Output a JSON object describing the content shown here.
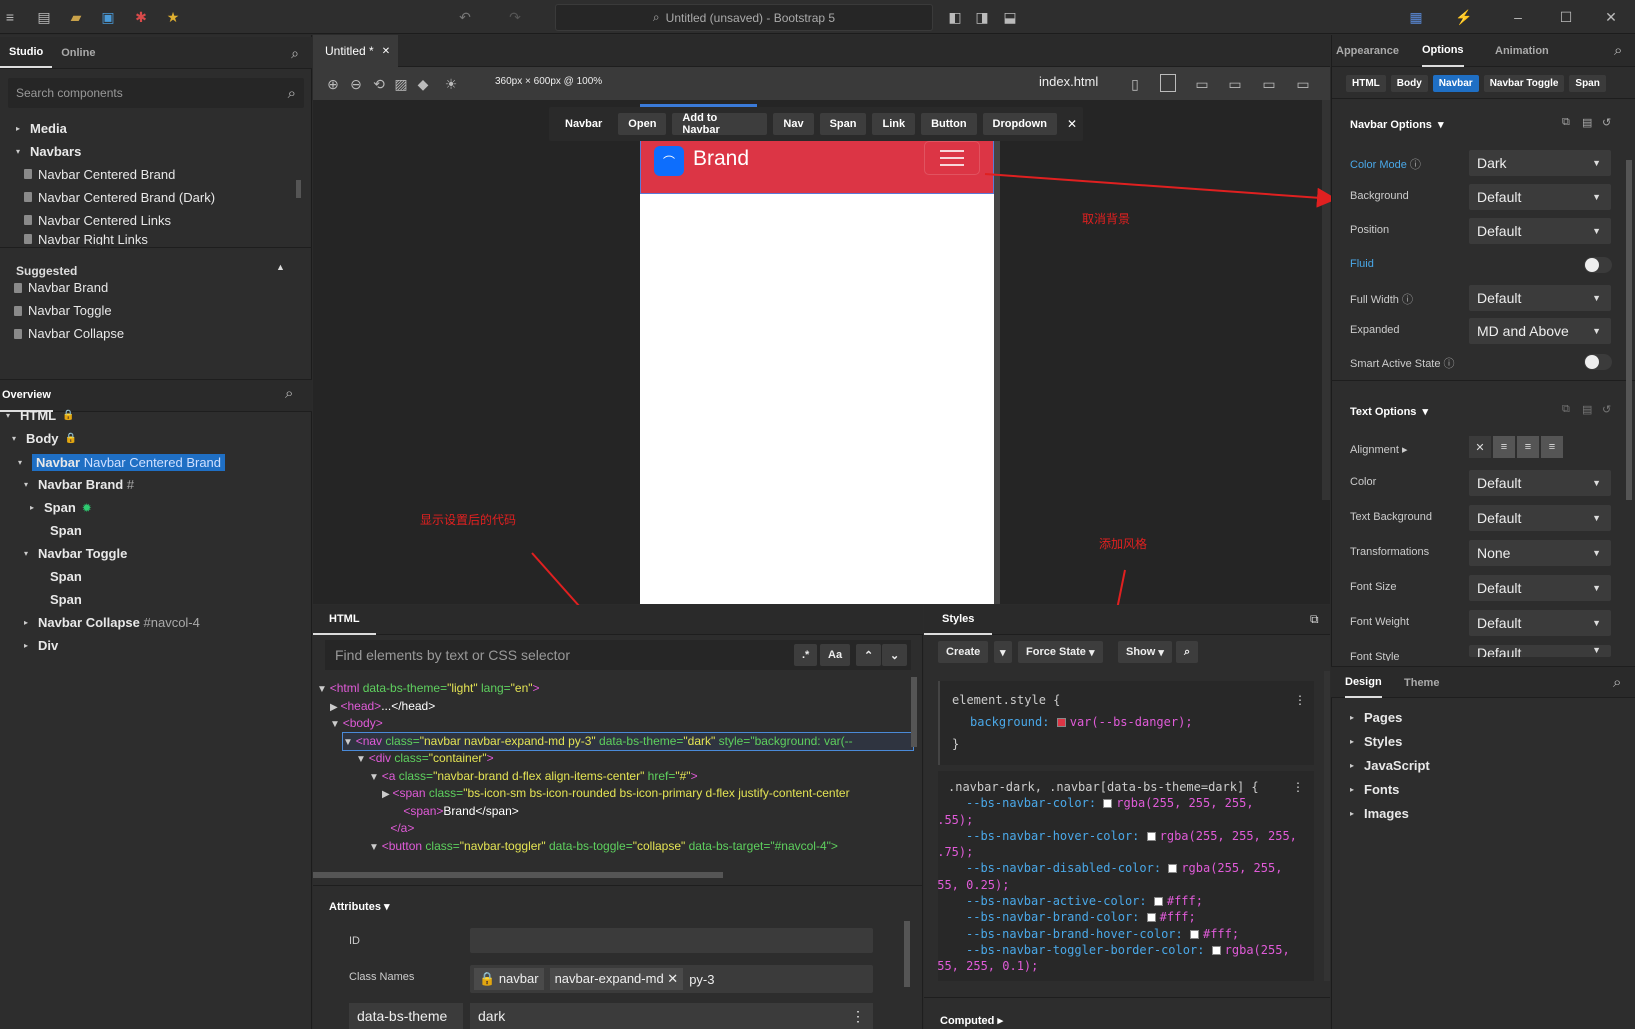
{
  "title_bar": {
    "title": "Untitled (unsaved) - Bootstrap 5"
  },
  "left": {
    "tabs": [
      "Studio",
      "Online"
    ],
    "search_placeholder": "Search components",
    "components": [
      {
        "label": "Media",
        "kind": "group",
        "expanded": false
      },
      {
        "label": "Navbars",
        "kind": "group",
        "expanded": true
      },
      {
        "label": "Navbar Centered Brand",
        "kind": "item"
      },
      {
        "label": "Navbar Centered Brand (Dark)",
        "kind": "item"
      },
      {
        "label": "Navbar Centered Links",
        "kind": "item"
      },
      {
        "label": "Navbar Right Links",
        "kind": "item"
      }
    ],
    "suggested_title": "Suggested",
    "suggested": [
      "Navbar Brand",
      "Navbar Toggle",
      "Navbar Collapse"
    ],
    "overview_title": "Overview",
    "overview": [
      {
        "label": "HTML",
        "sub": ""
      },
      {
        "label": "Body",
        "sub": ""
      },
      {
        "label": "Navbar",
        "sub": "Navbar Centered Brand"
      },
      {
        "label": "Navbar Brand",
        "sub": "#"
      },
      {
        "label": "Span",
        "sub": ""
      },
      {
        "label": "Span",
        "sub": ""
      },
      {
        "label": "Navbar Toggle",
        "sub": ""
      },
      {
        "label": "Span",
        "sub": ""
      },
      {
        "label": "Span",
        "sub": ""
      },
      {
        "label": "Navbar Collapse",
        "sub": "#navcol-4"
      },
      {
        "label": "Div",
        "sub": ""
      }
    ]
  },
  "editor": {
    "tab": "Untitled *",
    "viewport": "360px × 600px @ 100%",
    "file": "index.html",
    "context_bar": [
      "Navbar",
      "Open",
      "Add to Navbar",
      "Nav",
      "Span",
      "Link",
      "Button",
      "Dropdown"
    ],
    "brand": "Brand",
    "navbar_color": "#dc3545"
  },
  "annotations": {
    "remove_bg": "取消背景",
    "show_code": "显示设置后的代码",
    "add_style": "添加风格"
  },
  "html_panel": {
    "title": "HTML",
    "find_placeholder": "Find elements by text or CSS selector",
    "case_btn": "Aa",
    "lines": [
      {
        "tag": "<html ",
        "attr": "data-bs-theme=",
        "val": "\"light\"",
        "attr2": " lang=",
        "val2": "\"en\"",
        "tail": ">"
      },
      {
        "tag": "<head>",
        "attr": "",
        "val": "",
        "attr2": "",
        "val2": "",
        "tail": "...</head>"
      },
      {
        "tag": "<body>",
        "attr": "",
        "val": "",
        "attr2": "",
        "val2": "",
        "tail": ""
      },
      {
        "tag": "<nav ",
        "attr": "class=",
        "val": "\"navbar navbar-expand-md py-3\"",
        "attr2": " data-bs-theme=",
        "val2": "\"dark\"",
        "tail": " style=\"background: var(--"
      },
      {
        "tag": "<div ",
        "attr": "class=",
        "val": "\"container\"",
        "attr2": "",
        "val2": "",
        "tail": ">"
      },
      {
        "tag": "<a ",
        "attr": "class=",
        "val": "\"navbar-brand d-flex align-items-center\"",
        "attr2": " href=",
        "val2": "\"#\"",
        "tail": ">"
      },
      {
        "tag": "<span ",
        "attr": "class=",
        "val": "\"bs-icon-sm bs-icon-rounded bs-icon-primary d-flex justify-content-center",
        "attr2": "",
        "val2": "",
        "tail": ""
      },
      {
        "tag": "<span>",
        "attr": "",
        "val": "",
        "attr2": "",
        "val2": "",
        "tail": "Brand</span>"
      },
      {
        "tag": "</a>",
        "attr": "",
        "val": "",
        "attr2": "",
        "val2": "",
        "tail": ""
      },
      {
        "tag": "<button ",
        "attr": "class=",
        "val": "\"navbar-toggler\"",
        "attr2": " data-bs-toggle=",
        "val2": "\"collapse\"",
        "tail": " data-bs-target=\"#navcol-4\">"
      }
    ]
  },
  "attributes": {
    "title": "Attributes",
    "id_label": "ID",
    "class_label": "Class Names",
    "classes": [
      "navbar",
      "navbar-expand-md"
    ],
    "class_input": "py-3",
    "attr_name": "data-bs-theme",
    "attr_value": "dark"
  },
  "styles": {
    "title": "Styles",
    "buttons": [
      "Create",
      "Force State",
      "Show"
    ],
    "element_style_selector": "element.style {",
    "element_style_prop": "background:",
    "element_style_val": "var(--bs-danger);",
    "rule_selector": ".navbar-dark, .navbar[data-bs-theme=dark] {",
    "rule_lines": [
      {
        "prop": "--bs-navbar-color:",
        "val": "rgba(255, 255, 255,",
        "cont": "0.55);"
      },
      {
        "prop": "--bs-navbar-hover-color:",
        "val": "rgba(255, 255, 255,",
        "cont": "0.75);"
      },
      {
        "prop": "--bs-navbar-disabled-color:",
        "val": "rgba(255, 255,",
        "cont": "255, 0.25);"
      },
      {
        "prop": "--bs-navbar-active-color:",
        "val": "#fff;",
        "cont": ""
      },
      {
        "prop": "--bs-navbar-brand-color:",
        "val": "#fff;",
        "cont": ""
      },
      {
        "prop": "--bs-navbar-brand-hover-color:",
        "val": "#fff;",
        "cont": ""
      },
      {
        "prop": "--bs-navbar-toggler-border-color:",
        "val": "rgba(255,",
        "cont": "255, 255, 0.1);"
      }
    ],
    "computed": "Computed"
  },
  "right": {
    "tabs": [
      "Appearance",
      "Options",
      "Animation"
    ],
    "crumbs": [
      "HTML",
      "Body",
      "Navbar",
      "Navbar Toggle",
      "Span"
    ],
    "navbar_options_title": "Navbar Options",
    "navbar_options": [
      {
        "label": "Color Mode",
        "value": "Dark",
        "type": "select",
        "help": true,
        "blue": true
      },
      {
        "label": "Background",
        "value": "Default",
        "type": "select",
        "help": false,
        "blue": false
      },
      {
        "label": "Position",
        "value": "Default",
        "type": "select",
        "help": false,
        "blue": false
      },
      {
        "label": "Fluid",
        "value": "",
        "type": "toggle",
        "help": false,
        "blue": true
      },
      {
        "label": "Full Width",
        "value": "Default",
        "type": "select",
        "help": true,
        "blue": false
      },
      {
        "label": "Expanded",
        "value": "MD and Above",
        "type": "select",
        "help": false,
        "blue": false
      },
      {
        "label": "Smart Active State",
        "value": "",
        "type": "toggle",
        "help": true,
        "blue": false
      }
    ],
    "text_options_title": "Text Options",
    "alignment_label": "Alignment",
    "text_options": [
      {
        "label": "Color",
        "value": "Default"
      },
      {
        "label": "Text Background",
        "value": "Default"
      },
      {
        "label": "Transformations",
        "value": "None"
      },
      {
        "label": "Font Size",
        "value": "Default"
      },
      {
        "label": "Font Weight",
        "value": "Default"
      },
      {
        "label": "Font Style",
        "value": "Default"
      }
    ],
    "design_tabs": [
      "Design",
      "Theme"
    ],
    "design_items": [
      "Pages",
      "Styles",
      "JavaScript",
      "Fonts",
      "Images"
    ]
  }
}
